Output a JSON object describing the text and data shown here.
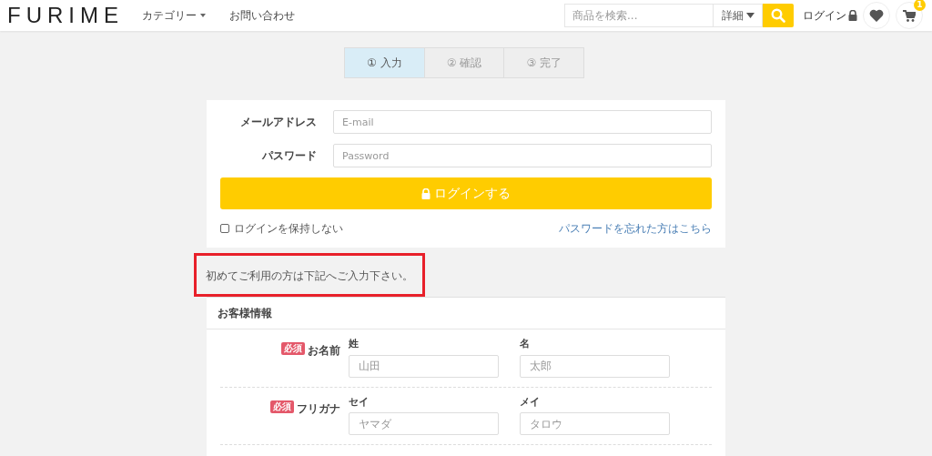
{
  "header": {
    "logo": "FURIME",
    "nav": [
      {
        "label": "カテゴリー",
        "dropdown": true
      },
      {
        "label": "お問い合わせ",
        "dropdown": false
      }
    ],
    "search": {
      "placeholder": "商品を検索...",
      "detail": "詳細"
    },
    "login": "ログイン",
    "cart_count": "1"
  },
  "steps": [
    {
      "label": "① 入力",
      "selected": true
    },
    {
      "label": "② 確認",
      "selected": false
    },
    {
      "label": "③ 完了",
      "selected": false
    }
  ],
  "login_form": {
    "fields": [
      {
        "label": "メールアドレス",
        "placeholder": "E-mail"
      },
      {
        "label": "パスワード",
        "placeholder": "Password"
      }
    ],
    "submit": "ログインする",
    "keep_login": {
      "label": "ログインを保持しない",
      "checked": false
    },
    "forgot_link": "パスワードを忘れた方はこちら"
  },
  "notice": {
    "text": "初めてご利用の方は下記へご入力下さい。",
    "highlighted": true
  },
  "customer": {
    "title": "お客様情報",
    "rows": [
      {
        "badge": "必須",
        "label": "お名前",
        "subfields": [
          {
            "label": "姓",
            "placeholder": "山田"
          },
          {
            "label": "名",
            "placeholder": "太郎"
          }
        ]
      },
      {
        "badge": "必須",
        "label": "フリガナ",
        "subfields": [
          {
            "label": "セイ",
            "placeholder": "ヤマダ"
          },
          {
            "label": "メイ",
            "placeholder": "タロウ"
          }
        ]
      }
    ]
  }
}
